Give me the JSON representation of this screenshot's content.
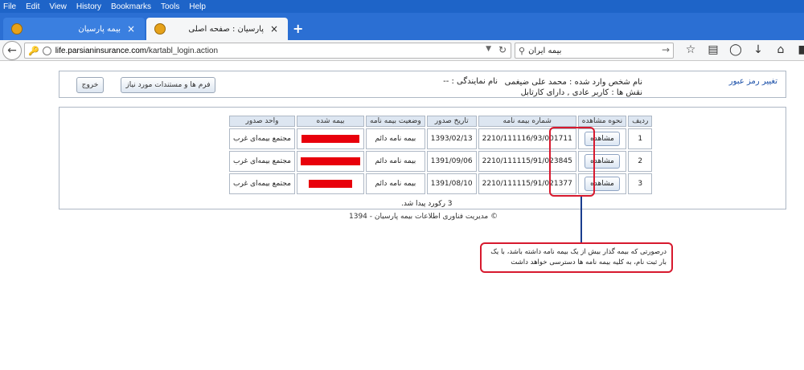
{
  "menu": [
    "File",
    "Edit",
    "View",
    "History",
    "Bookmarks",
    "Tools",
    "Help"
  ],
  "tabs": [
    {
      "title": "بیمه پارسیان",
      "close": "×"
    },
    {
      "title": "پارسیان : صفحه اصلی",
      "close": "×"
    }
  ],
  "new_tab": "+",
  "address": {
    "url_host": "life.parsianinsurance.com",
    "url_path": "/kartabl_login.action"
  },
  "search": {
    "query": "بیمه ایران"
  },
  "header": {
    "change_password": "تغییر رمز عبور",
    "user_line1": "نام شخص وارد شده : محمد علی ضیغمی",
    "user_line2": "نقش ها : کاربر عادی , دارای کارتابل",
    "agent": "نام نمایندگی : --",
    "forms_button": "فرم ها و مستندات مورد نیاز",
    "exit_button": "خروج"
  },
  "table": {
    "headers": [
      "ردیف",
      "نحوه مشاهده",
      "شماره بیمه نامه",
      "تاریخ صدور",
      "وضعیت بیمه نامه",
      "بیمه شده",
      "واحد صدور"
    ],
    "rows": [
      {
        "row": "1",
        "view": "مشاهده",
        "number": "2210/111116/93/001711",
        "date": "1393/02/13",
        "status": "بیمه نامه دائم",
        "unit": "مجتمع بیمه‌ای غرب"
      },
      {
        "row": "2",
        "view": "مشاهده",
        "number": "2210/111115/91/023845",
        "date": "1391/09/06",
        "status": "بیمه نامه دائم",
        "unit": "مجتمع بیمه‌ای غرب"
      },
      {
        "row": "3",
        "view": "مشاهده",
        "number": "2210/111115/91/021377",
        "date": "1391/08/10",
        "status": "بیمه نامه دائم",
        "unit": "مجتمع بیمه‌ای غرب"
      }
    ],
    "record_count": "3 رکورد پیدا شد."
  },
  "footer": "© مدیریت فناوری اطلاعات بیمه پارسیان - 1394",
  "callout": "درصورتی که بیمه گذار بیش از یک بیمه نامه داشته باشد، با یک بار ثبت نام، به کلیه بیمه نامه ها دسترسی خواهد داشت"
}
